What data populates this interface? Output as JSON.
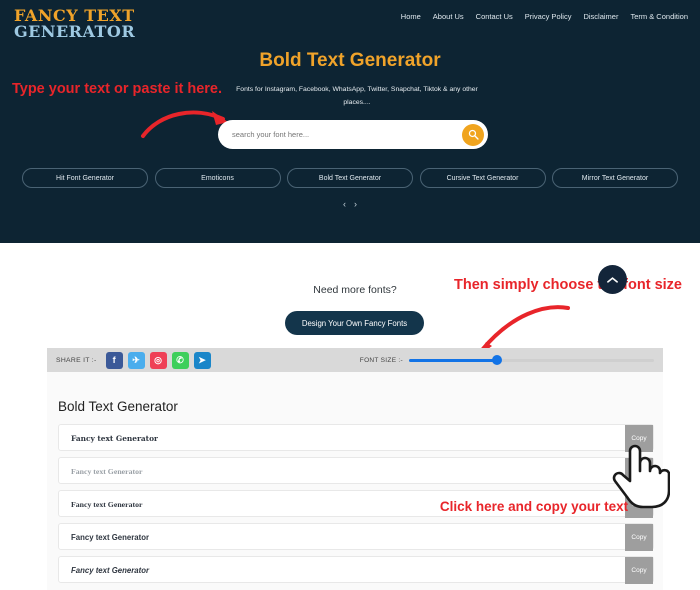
{
  "site": {
    "logo_line1": "FANCY TEXT",
    "logo_line2": "GENERATOR"
  },
  "nav": {
    "items": [
      {
        "label": "Home"
      },
      {
        "label": "About Us"
      },
      {
        "label": "Contact Us"
      },
      {
        "label": "Privacy Policy"
      },
      {
        "label": "Disclaimer"
      },
      {
        "label": "Term & Condition"
      }
    ]
  },
  "hero": {
    "title": "Bold Text Generator",
    "subtitle": "Fonts for Instagram, Facebook, WhatsApp, Twitter, Snapchat, Tiktok & any other places....",
    "search_placeholder": "search your font here...",
    "search_value": "",
    "search_icon": "search-icon",
    "categories": [
      {
        "label": "Hit Font Generator"
      },
      {
        "label": "Emoticons"
      },
      {
        "label": "Bold Text Generator"
      },
      {
        "label": "Cursive Text Generator"
      },
      {
        "label": "Mirror Text Generator"
      }
    ],
    "carousel_prev": "‹",
    "carousel_next": "›",
    "bg_color": "#0d2433",
    "accent_color": "#f0a32a"
  },
  "annotations": {
    "left": "Type your text or paste it here.",
    "right": "Then simply choose the font size",
    "copy": "Click here and copy your text",
    "color": "#e8252a"
  },
  "promo": {
    "question": "Need more fonts?",
    "button_label": "Design Your Own Fancy Fonts"
  },
  "scroll_top": {
    "icon": "chevron-up-icon"
  },
  "toolbar": {
    "share_label": "SHARE IT :-",
    "socials": [
      {
        "name": "facebook-icon",
        "glyph": "f",
        "color": "#3b5998"
      },
      {
        "name": "twitter-icon",
        "glyph": "✈",
        "color": "#4aaded"
      },
      {
        "name": "instagram-icon",
        "glyph": "◎",
        "color": "#ef4056"
      },
      {
        "name": "whatsapp-icon",
        "glyph": "✆",
        "color": "#3ecf5b"
      },
      {
        "name": "telegram-icon",
        "glyph": "➤",
        "color": "#1a86c9"
      }
    ],
    "fontsize_label": "FONT SIZE :-",
    "fontsize_percent": 36,
    "slider_color": "#1273e6"
  },
  "panel": {
    "title": "Bold Text Generator",
    "copy_label": "Copy",
    "rows": [
      {
        "text": "Fancy text Generator",
        "style": "f-fraktur"
      },
      {
        "text": "Fancy text Generator",
        "style": "f-serif-light"
      },
      {
        "text": "Fancy text Generator",
        "style": "f-serif-bold"
      },
      {
        "text": "Fancy text Generator",
        "style": "f-sans-bold"
      },
      {
        "text": "Fancy text Generator",
        "style": "f-sans-bold-italic"
      }
    ]
  },
  "cursor": {
    "name": "hand-pointer-cursor"
  }
}
